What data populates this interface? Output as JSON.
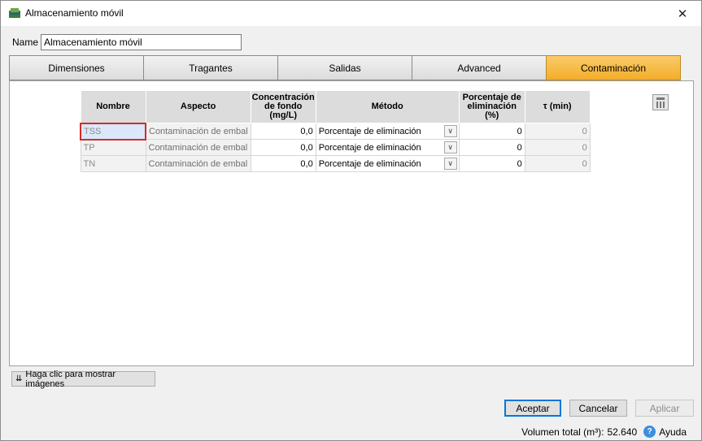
{
  "window": {
    "title": "Almacenamiento móvil",
    "close_icon": "✕"
  },
  "name_field": {
    "label": "Name",
    "value": "Almacenamiento móvil"
  },
  "tabs": [
    {
      "label": "Dimensiones",
      "active": false
    },
    {
      "label": "Tragantes",
      "active": false
    },
    {
      "label": "Salidas",
      "active": false
    },
    {
      "label": "Advanced",
      "active": false
    },
    {
      "label": "Contaminación",
      "active": true
    }
  ],
  "table": {
    "headers": {
      "name": "Nombre",
      "aspect": "Aspecto",
      "conc_line1": "Concentración",
      "conc_line2": "de fondo",
      "conc_line3": "(mg/L)",
      "method": "Método",
      "pct_line1": "Porcentaje de",
      "pct_line2": "eliminación",
      "pct_line3": "(%)",
      "tau": "τ (min)"
    },
    "rows": [
      {
        "name": "TSS",
        "aspect": "Contaminación de embal",
        "conc": "0,0",
        "method": "Porcentaje de eliminación",
        "pct": "0",
        "tau": "0"
      },
      {
        "name": "TP",
        "aspect": "Contaminación de embal",
        "conc": "0,0",
        "method": "Porcentaje de eliminación",
        "pct": "0",
        "tau": "0"
      },
      {
        "name": "TN",
        "aspect": "Contaminación de embal",
        "conc": "0,0",
        "method": "Porcentaje de eliminación",
        "pct": "0",
        "tau": "0"
      }
    ]
  },
  "show_images_button": "Haga clic para mostrar imágenes",
  "buttons": {
    "accept": "Aceptar",
    "cancel": "Cancelar",
    "apply": "Aplicar"
  },
  "status": {
    "volume_label": "Volumen total (m³):",
    "volume_value": "52.640",
    "help": "Ayuda"
  },
  "accent_colors": {
    "active_tab": "#f3ad2a",
    "selection_border": "#d42a2a",
    "selection_fill": "#dbe8fb"
  }
}
